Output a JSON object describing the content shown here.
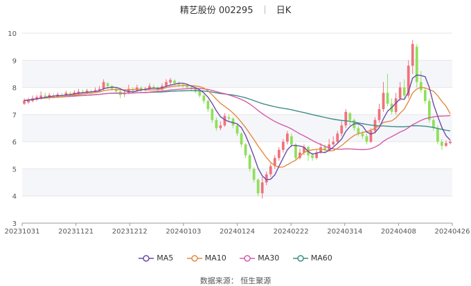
{
  "title": {
    "name": "精艺股份",
    "code": "002295",
    "period": "日K"
  },
  "source": "数据来源： 恒生聚源",
  "colors": {
    "up": "#f0727b",
    "down": "#8ee05a",
    "ma5": "#6a4aa8",
    "ma10": "#e48a3c",
    "ma30": "#d65aa8",
    "ma60": "#3a8c86"
  },
  "chart_data": {
    "type": "candlestick",
    "y_ticks": [
      3,
      4,
      5,
      6,
      7,
      8,
      9,
      10
    ],
    "ylim": [
      3,
      10
    ],
    "x_labels": [
      "20231031",
      "20231121",
      "20231212",
      "20240103",
      "20240124",
      "20240222",
      "20240314",
      "20240408",
      "20240426"
    ],
    "legend": [
      "MA5",
      "MA10",
      "MA30",
      "MA60"
    ],
    "grid": "horizontal",
    "legend_position": "bottom",
    "candles": [
      [
        7.4,
        7.52,
        7.6,
        7.35
      ],
      [
        7.45,
        7.55,
        7.62,
        7.4
      ],
      [
        7.5,
        7.6,
        7.7,
        7.45
      ],
      [
        7.55,
        7.65,
        7.72,
        7.5
      ],
      [
        7.58,
        7.7,
        7.85,
        7.55
      ],
      [
        7.7,
        7.65,
        7.8,
        7.58
      ],
      [
        7.62,
        7.72,
        7.8,
        7.55
      ],
      [
        7.7,
        7.68,
        7.78,
        7.6
      ],
      [
        7.66,
        7.74,
        7.82,
        7.62
      ],
      [
        7.72,
        7.7,
        7.8,
        7.62
      ],
      [
        7.7,
        7.8,
        7.88,
        7.65
      ],
      [
        7.78,
        7.76,
        7.85,
        7.7
      ],
      [
        7.76,
        7.82,
        7.9,
        7.72
      ],
      [
        7.8,
        7.85,
        7.95,
        7.75
      ],
      [
        7.84,
        7.8,
        7.92,
        7.74
      ],
      [
        7.8,
        7.88,
        7.95,
        7.76
      ],
      [
        7.86,
        7.84,
        7.92,
        7.78
      ],
      [
        7.84,
        7.9,
        8.0,
        7.8
      ],
      [
        7.9,
        7.95,
        8.05,
        7.85
      ],
      [
        7.95,
        8.2,
        8.3,
        7.9
      ],
      [
        8.15,
        8.05,
        8.2,
        7.95
      ],
      [
        8.05,
        7.95,
        8.1,
        7.88
      ],
      [
        7.95,
        7.85,
        8.0,
        7.78
      ],
      [
        7.85,
        7.72,
        7.92,
        7.6
      ],
      [
        7.75,
        7.8,
        7.9,
        7.65
      ],
      [
        7.8,
        7.95,
        8.1,
        7.75
      ],
      [
        7.92,
        7.88,
        8.0,
        7.8
      ],
      [
        7.88,
        8.0,
        8.1,
        7.85
      ],
      [
        7.98,
        7.9,
        8.05,
        7.82
      ],
      [
        7.9,
        7.95,
        8.02,
        7.85
      ],
      [
        7.95,
        8.05,
        8.15,
        7.9
      ],
      [
        8.02,
        8.0,
        8.1,
        7.92
      ],
      [
        8.0,
        7.9,
        8.05,
        7.85
      ],
      [
        7.92,
        8.05,
        8.15,
        7.88
      ],
      [
        8.05,
        8.2,
        8.3,
        8.0
      ],
      [
        8.18,
        8.28,
        8.35,
        8.1
      ],
      [
        8.25,
        8.15,
        8.3,
        8.08
      ],
      [
        8.15,
        8.1,
        8.22,
        8.02
      ],
      [
        8.1,
        8.05,
        8.15,
        7.98
      ],
      [
        8.05,
        8.0,
        8.12,
        7.95
      ],
      [
        8.0,
        7.95,
        8.05,
        7.88
      ],
      [
        7.95,
        7.85,
        8.0,
        7.78
      ],
      [
        7.85,
        7.7,
        7.9,
        7.62
      ],
      [
        7.7,
        7.5,
        7.75,
        7.4
      ],
      [
        7.5,
        7.2,
        7.55,
        7.1
      ],
      [
        7.2,
        6.8,
        7.25,
        6.7
      ],
      [
        6.8,
        6.5,
        6.9,
        6.4
      ],
      [
        6.5,
        6.6,
        6.75,
        6.42
      ],
      [
        6.6,
        6.95,
        7.05,
        6.55
      ],
      [
        6.9,
        6.85,
        7.0,
        6.75
      ],
      [
        6.85,
        6.6,
        6.9,
        6.5
      ],
      [
        6.6,
        6.3,
        6.65,
        6.2
      ],
      [
        6.3,
        5.9,
        6.35,
        5.8
      ],
      [
        5.9,
        5.5,
        5.95,
        5.4
      ],
      [
        5.5,
        5.0,
        5.55,
        4.9
      ],
      [
        5.0,
        4.6,
        5.05,
        4.5
      ],
      [
        4.6,
        4.1,
        4.65,
        4.0
      ],
      [
        4.1,
        4.5,
        4.7,
        3.9
      ],
      [
        4.5,
        4.8,
        4.9,
        4.4
      ],
      [
        4.8,
        5.1,
        5.2,
        4.7
      ],
      [
        5.1,
        5.4,
        5.5,
        5.0
      ],
      [
        5.4,
        5.7,
        5.8,
        5.3
      ],
      [
        5.7,
        6.0,
        6.1,
        5.6
      ],
      [
        6.0,
        6.3,
        6.4,
        5.9
      ],
      [
        6.2,
        5.9,
        6.3,
        5.8
      ],
      [
        5.9,
        5.4,
        5.95,
        5.3
      ],
      [
        5.4,
        5.6,
        5.75,
        5.35
      ],
      [
        5.6,
        5.8,
        5.9,
        5.5
      ],
      [
        5.8,
        5.5,
        5.85,
        5.3
      ],
      [
        5.5,
        5.4,
        5.6,
        5.3
      ],
      [
        5.4,
        5.6,
        5.7,
        5.35
      ],
      [
        5.6,
        5.8,
        5.95,
        5.55
      ],
      [
        5.8,
        5.7,
        5.9,
        5.6
      ],
      [
        5.7,
        5.9,
        6.1,
        5.65
      ],
      [
        5.9,
        6.0,
        6.2,
        5.85
      ],
      [
        6.0,
        6.3,
        6.4,
        5.95
      ],
      [
        6.3,
        6.6,
        6.8,
        6.2
      ],
      [
        6.6,
        7.1,
        7.2,
        6.5
      ],
      [
        7.05,
        6.8,
        7.1,
        6.6
      ],
      [
        6.8,
        6.5,
        6.85,
        6.4
      ],
      [
        6.5,
        6.3,
        6.6,
        6.2
      ],
      [
        6.3,
        6.2,
        6.4,
        6.1
      ],
      [
        6.2,
        6.0,
        6.3,
        5.9
      ],
      [
        6.0,
        6.4,
        6.5,
        5.95
      ],
      [
        6.4,
        6.8,
        6.9,
        6.3
      ],
      [
        6.8,
        7.2,
        7.4,
        6.7
      ],
      [
        7.2,
        7.8,
        8.2,
        7.1
      ],
      [
        7.8,
        7.4,
        8.5,
        7.3
      ],
      [
        7.4,
        7.1,
        7.6,
        7.0
      ],
      [
        7.1,
        7.6,
        7.8,
        7.0
      ],
      [
        7.6,
        8.0,
        8.2,
        7.5
      ],
      [
        8.0,
        7.7,
        8.3,
        7.6
      ],
      [
        7.7,
        8.8,
        9.0,
        7.6
      ],
      [
        8.8,
        9.6,
        9.75,
        8.5
      ],
      [
        9.5,
        8.2,
        9.6,
        8.0
      ],
      [
        8.2,
        7.9,
        8.6,
        7.8
      ],
      [
        7.9,
        7.5,
        8.0,
        7.4
      ],
      [
        7.5,
        6.8,
        7.6,
        6.7
      ],
      [
        6.8,
        6.5,
        6.9,
        6.4
      ],
      [
        6.5,
        6.0,
        6.6,
        5.9
      ],
      [
        6.0,
        5.85,
        6.1,
        5.7
      ],
      [
        5.85,
        5.95,
        6.05,
        5.8
      ],
      [
        5.95,
        6.0,
        6.05,
        5.9
      ]
    ]
  }
}
